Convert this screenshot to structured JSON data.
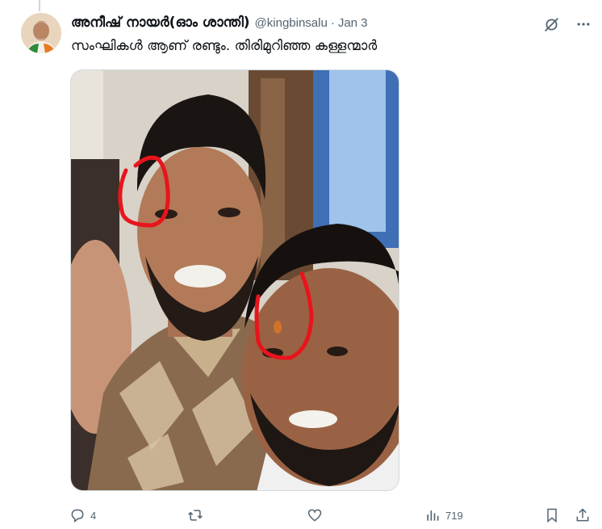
{
  "tweet": {
    "author_name": "അനീഷ് നായർ(ഓം ശാന്തി)",
    "author_handle": "@kingbinsalu",
    "separator": "·",
    "date": "Jan 3",
    "text": "സംഘികൾ ആണ് രണ്ടും. തിരിമുറിഞ്ഞ കള്ളന്മാർ"
  },
  "icons": {
    "grok": "grok-icon",
    "more": "more-icon",
    "reply": "reply-icon",
    "retweet": "retweet-icon",
    "like": "like-icon",
    "views": "views-icon",
    "bookmark": "bookmark-icon",
    "share": "share-icon"
  },
  "actions": {
    "reply_count": "4",
    "retweet_count": "",
    "like_count": "",
    "view_count": "719"
  },
  "colors": {
    "text_primary": "#0f1419",
    "text_secondary": "#536471",
    "annotation_red": "#e8141c",
    "border": "#cfd9de"
  }
}
